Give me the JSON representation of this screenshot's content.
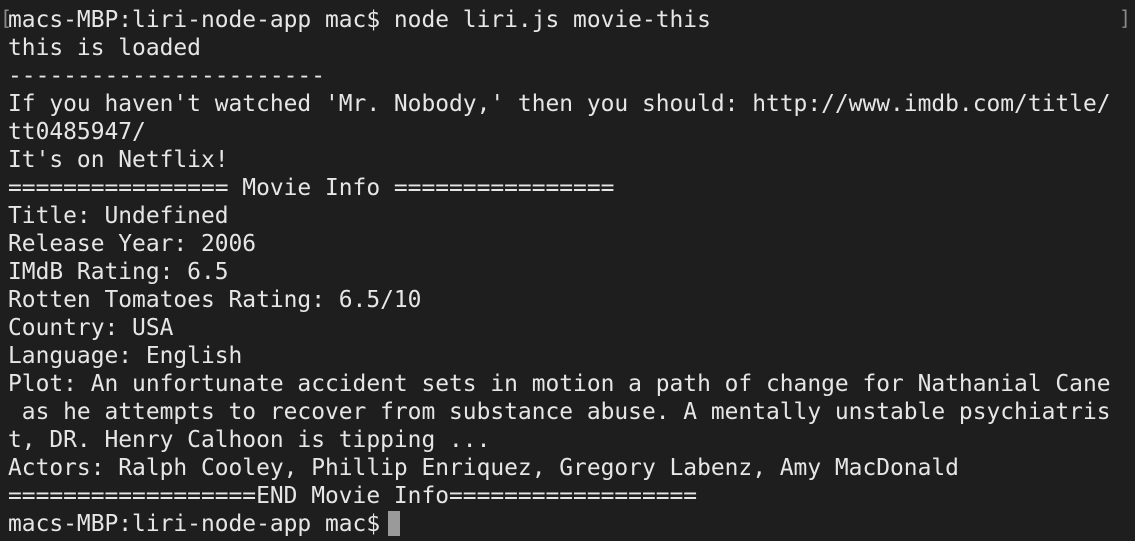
{
  "terminal": {
    "bracket_left": "[",
    "bracket_right": "]",
    "lines": [
      "macs-MBP:liri-node-app mac$ node liri.js movie-this",
      "this is loaded",
      "-----------------------",
      "If you haven't watched 'Mr. Nobody,' then you should: http://www.imdb.com/title/",
      "tt0485947/",
      "It's on Netflix!",
      "================ Movie Info ================",
      "Title: Undefined",
      "Release Year: 2006",
      "IMdB Rating: 6.5",
      "Rotten Tomatoes Rating: 6.5/10",
      "Country: USA",
      "Language: English",
      "Plot: An unfortunate accident sets in motion a path of change for Nathanial Cane",
      " as he attempts to recover from substance abuse. A mentally unstable psychiatris",
      "t, DR. Henry Calhoon is tipping ...",
      "Actors: Ralph Cooley, Phillip Enriquez, Gregory Labenz, Amy MacDonald",
      "==================END Movie Info==================",
      "macs-MBP:liri-node-app mac$"
    ],
    "colors": {
      "background": "#1e1e1e",
      "text": "#e6e6e6",
      "cursor": "#9a9a9a"
    }
  }
}
